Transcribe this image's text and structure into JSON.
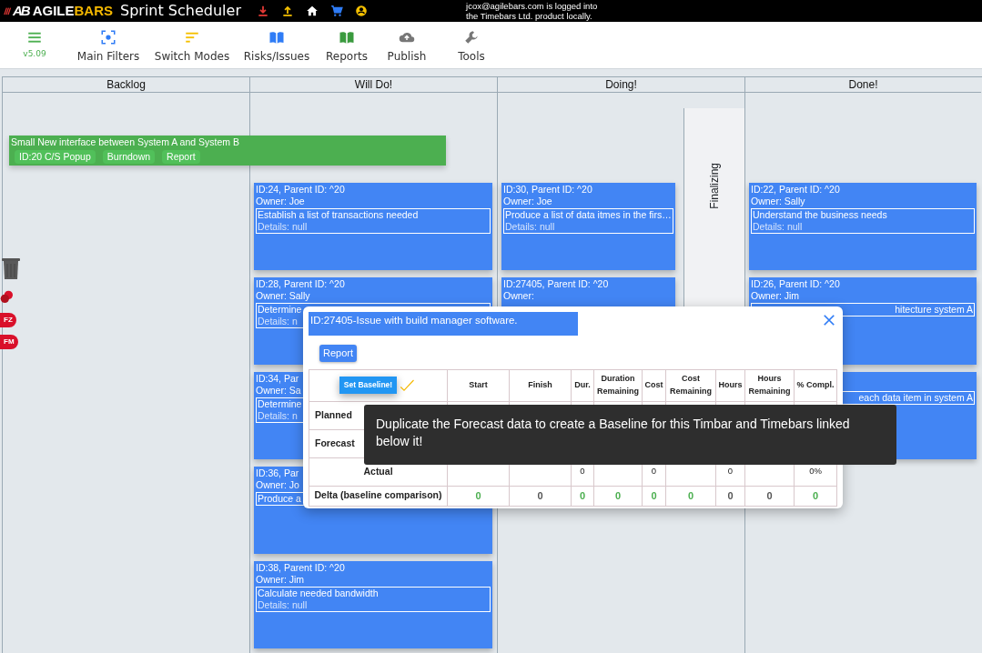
{
  "header": {
    "logo_mark": "AB",
    "logo_first": "AGILE",
    "logo_second": "BARS",
    "title": "Sprint Scheduler",
    "login_lines": [
      "jcox@agilebars.com is logged into",
      "the Timebars Ltd. product locally."
    ]
  },
  "toolbar": [
    {
      "label": "v5.09"
    },
    {
      "label": "Main Filters"
    },
    {
      "label": "Switch Modes"
    },
    {
      "label": "Risks/Issues"
    },
    {
      "label": "Reports"
    },
    {
      "label": "Publish"
    },
    {
      "label": "Tools"
    }
  ],
  "side_tags": [
    "FZ",
    "FM"
  ],
  "summary_bar": {
    "title": "Small New interface between System A and System B",
    "buttons": [
      "ID:20 C/S Popup",
      "Burndown",
      "Report"
    ]
  },
  "columns": [
    {
      "title": "Backlog"
    },
    {
      "title": "Will Do!",
      "cards": [
        {
          "title": "ID:24, Parent ID: ^20",
          "owner": "Owner: Joe",
          "description": "Establish a list of transactions needed",
          "details": "Details: null"
        },
        {
          "title": "ID:28, Parent ID: ^20",
          "owner": "Owner: Sally",
          "description": "Determine",
          "details": "Details: n"
        },
        {
          "title": "ID:34, Par",
          "owner": "Owner: Sa",
          "description": "Determine",
          "details": "Details: n"
        },
        {
          "title": "ID:36, Par",
          "owner": "Owner: Jo",
          "description": "Produce a"
        },
        {
          "title": "ID:38, Parent ID: ^20",
          "owner": "Owner: Jim",
          "description": "Calculate needed bandwidth",
          "details": "Details: null"
        }
      ]
    },
    {
      "title": "Doing!",
      "lane": "Finalizing",
      "cards": [
        {
          "title": "ID:30, Parent ID: ^20",
          "owner": "Owner: Joe",
          "description": "Produce a list of data itmes in the firs…",
          "details": "Details: null"
        },
        {
          "title": "ID:27405, Parent ID: ^20",
          "owner": "Owner:"
        }
      ]
    },
    {
      "title": "Done!",
      "cards": [
        {
          "title": "ID:22, Parent ID: ^20",
          "owner": "Owner: Sally",
          "description": "Understand the business needs",
          "details": "Details: null"
        },
        {
          "kind": "cut",
          "title": "ID:26, Parent ID: ^20",
          "owner": "Owner: Jim",
          "description": "hitecture system A"
        },
        {
          "kind": "cut",
          "description": "each data item in system A"
        }
      ]
    }
  ],
  "modal": {
    "title": "ID:27405-Issue with build manager software.",
    "report_button": "Report",
    "baseline_button": "Set Baseline!",
    "columns": [
      "Start",
      "Finish",
      "Dur.",
      "Duration Remaining",
      "Cost",
      "Cost Remaining",
      "Hours",
      "Hours Remaining",
      "% Compl."
    ],
    "rows": [
      {
        "label": "Planned"
      },
      {
        "label": "Forecast"
      },
      {
        "label": "Actual",
        "cells": [
          "",
          "",
          "0",
          "",
          "0",
          "",
          "0",
          "",
          "0%"
        ]
      },
      {
        "label": "Delta (baseline comparison)",
        "cells": [
          {
            "text": "0",
            "color": "#4caf50"
          },
          {
            "text": "0",
            "color": "#555555"
          },
          {
            "text": "0",
            "color": "#4caf50"
          },
          {
            "text": "0",
            "color": "#4caf50"
          },
          {
            "text": "0",
            "color": "#4caf50"
          },
          {
            "text": "0",
            "color": "#4caf50"
          },
          {
            "text": "0",
            "color": "#555555"
          },
          {
            "text": "0",
            "color": "#555555"
          },
          {
            "text": "0",
            "color": "#4caf50"
          }
        ]
      }
    ]
  },
  "tooltip": "Duplicate the Forecast data to create a Baseline for this Timbar and Timebars linked below it!"
}
